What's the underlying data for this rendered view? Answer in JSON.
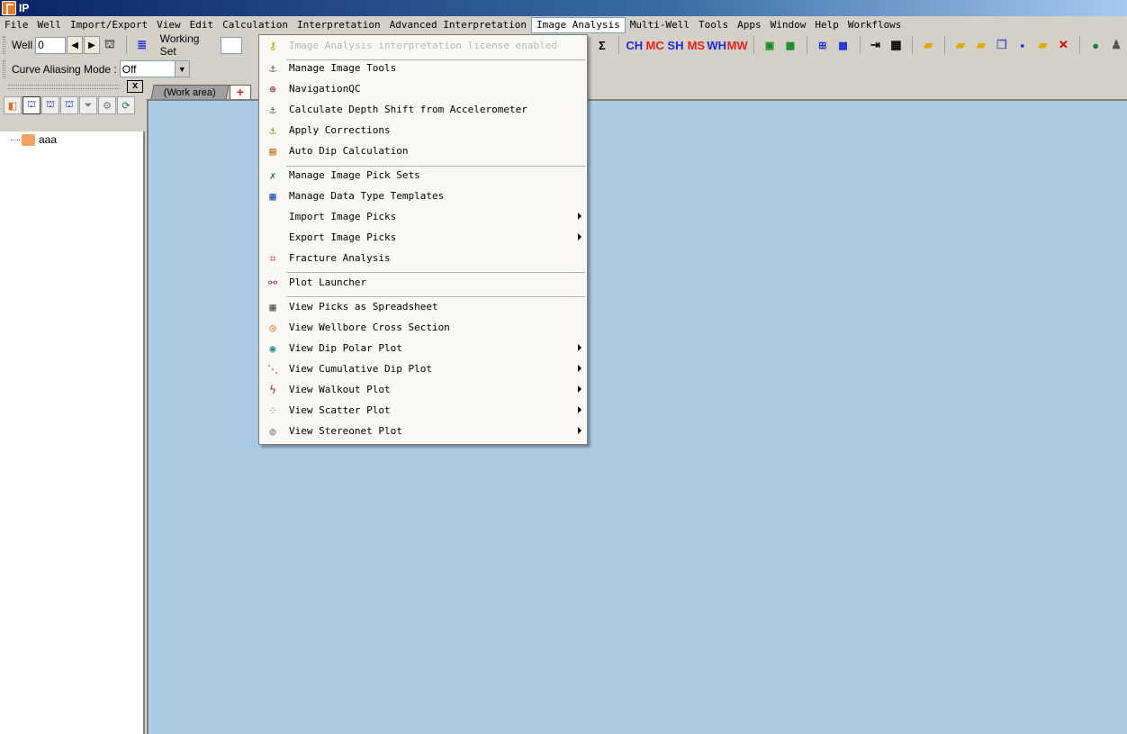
{
  "window": {
    "title": "IP"
  },
  "menubar": [
    "File",
    "Well",
    "Import/Export",
    "View",
    "Edit",
    "Calculation",
    "Interpretation",
    "Advanced Interpretation",
    "Image Analysis",
    "Multi-Well",
    "Tools",
    "Apps",
    "Window",
    "Help",
    "Workflows"
  ],
  "active_menu": "Image Analysis",
  "toolbar": {
    "well_label": "Well",
    "well_value": "0",
    "working_set_label": "Working Set",
    "sum_symbol": "Σ",
    "text_icons": [
      "CH",
      "MC",
      "SH",
      "MS",
      "WH",
      "MW"
    ]
  },
  "toolbar2": {
    "curve_aliasing_label": "Curve Aliasing Mode :",
    "curve_aliasing_value": "Off"
  },
  "left_panel": {
    "close_label": "x",
    "tree_node": "aaa"
  },
  "tabs": {
    "work_area": "(Work area)",
    "new_tab": "+"
  },
  "dropdown": {
    "items": [
      {
        "label": "Image Analysis interpretation license enabled",
        "icon": "key-icon",
        "disabled": true,
        "submenu": false
      },
      {
        "label": "Manage Image Tools",
        "icon": "image-tools-icon",
        "disabled": false,
        "submenu": false
      },
      {
        "label": "NavigationQC",
        "icon": "target-icon",
        "disabled": false,
        "submenu": false
      },
      {
        "label": "Calculate Depth Shift from Accelerometer",
        "icon": "depth-shift-icon",
        "disabled": false,
        "submenu": false
      },
      {
        "label": "Apply Corrections",
        "icon": "corrections-icon",
        "disabled": false,
        "submenu": false
      },
      {
        "label": "Auto Dip Calculation",
        "icon": "auto-dip-icon",
        "disabled": false,
        "submenu": false
      },
      {
        "label": "Manage Image Pick Sets",
        "icon": "pick-sets-icon",
        "disabled": false,
        "submenu": false
      },
      {
        "label": "Manage Data Type Templates",
        "icon": "templates-icon",
        "disabled": false,
        "submenu": false
      },
      {
        "label": "Import Image Picks",
        "icon": "",
        "disabled": false,
        "submenu": true
      },
      {
        "label": "Export Image Picks",
        "icon": "",
        "disabled": false,
        "submenu": true
      },
      {
        "label": "Fracture Analysis",
        "icon": "fracture-icon",
        "disabled": false,
        "submenu": false
      },
      {
        "label": "Plot Launcher",
        "icon": "plot-launcher-icon",
        "disabled": false,
        "submenu": false
      },
      {
        "label": "View Picks as Spreadsheet",
        "icon": "spreadsheet-icon",
        "disabled": false,
        "submenu": false
      },
      {
        "label": "View Wellbore Cross Section",
        "icon": "cross-section-icon",
        "disabled": false,
        "submenu": false
      },
      {
        "label": "View Dip Polar Plot",
        "icon": "polar-plot-icon",
        "disabled": false,
        "submenu": true
      },
      {
        "label": "View Cumulative Dip Plot",
        "icon": "cumulative-dip-icon",
        "disabled": false,
        "submenu": true
      },
      {
        "label": "View Walkout Plot",
        "icon": "walkout-icon",
        "disabled": false,
        "submenu": true
      },
      {
        "label": "View Scatter Plot",
        "icon": "scatter-icon",
        "disabled": false,
        "submenu": true
      },
      {
        "label": "View Stereonet Plot",
        "icon": "stereonet-icon",
        "disabled": false,
        "submenu": true
      }
    ]
  },
  "colors": {
    "workspace": "#abcbe5",
    "menu_bg": "#f9f8f3",
    "chrome": "#d4d0c8"
  }
}
